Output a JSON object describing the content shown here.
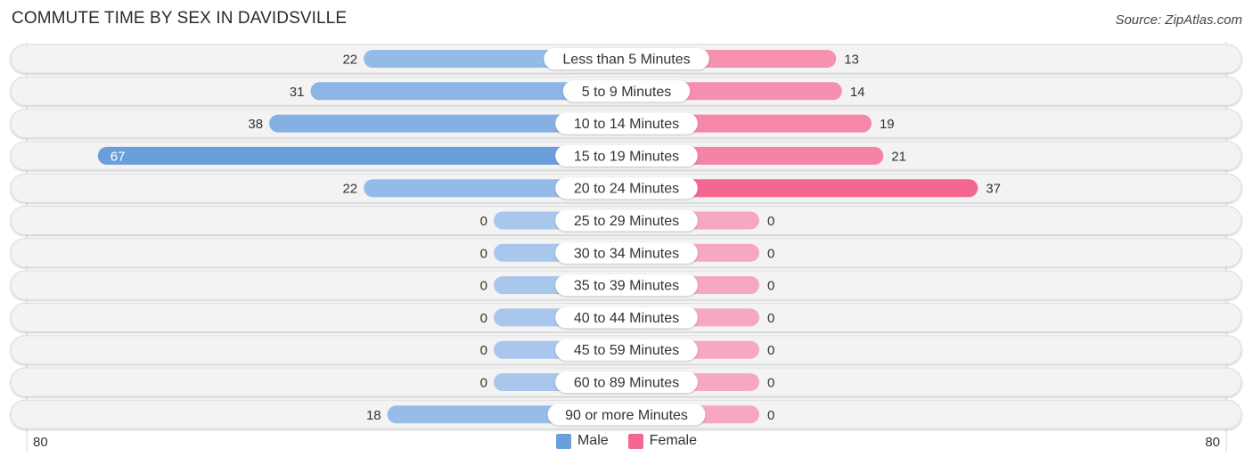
{
  "title": "COMMUTE TIME BY SEX IN DAVIDSVILLE",
  "source": "Source: ZipAtlas.com",
  "colors": {
    "male": "#6a9fdc",
    "male_light": "#a9c7ec",
    "female": "#f46791",
    "female_light": "#f7a8c1",
    "row_bg": "#f3f3f3"
  },
  "legend": [
    {
      "label": "Male",
      "color": "#6a9fdc"
    },
    {
      "label": "Female",
      "color": "#f46791"
    }
  ],
  "axis": {
    "left_label": "80",
    "right_label": "80"
  },
  "chart_data": {
    "type": "bar",
    "orientation": "horizontal-diverging",
    "title": "COMMUTE TIME BY SEX IN DAVIDSVILLE",
    "categories": [
      "Less than 5 Minutes",
      "5 to 9 Minutes",
      "10 to 14 Minutes",
      "15 to 19 Minutes",
      "20 to 24 Minutes",
      "25 to 29 Minutes",
      "30 to 34 Minutes",
      "35 to 39 Minutes",
      "40 to 44 Minutes",
      "45 to 59 Minutes",
      "60 to 89 Minutes",
      "90 or more Minutes"
    ],
    "series": [
      {
        "name": "Male",
        "values": [
          22,
          31,
          38,
          67,
          22,
          0,
          0,
          0,
          0,
          0,
          0,
          18
        ]
      },
      {
        "name": "Female",
        "values": [
          13,
          14,
          19,
          21,
          37,
          0,
          0,
          0,
          0,
          0,
          0,
          0
        ]
      }
    ],
    "xlim": [
      -80,
      80
    ],
    "xlabel": "",
    "ylabel": "",
    "legend_position": "bottom-center",
    "grid": false
  }
}
